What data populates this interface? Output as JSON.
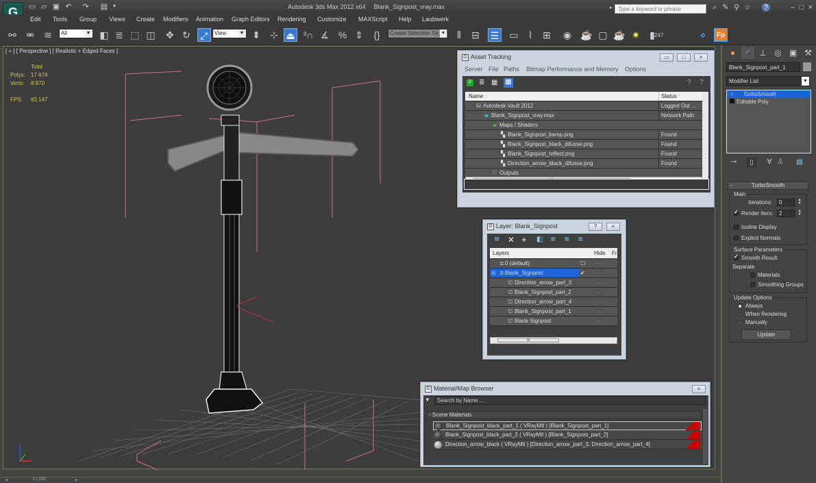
{
  "app": {
    "title": "Autodesk 3ds Max  2012 x64",
    "file": "Blank_Signpost_vray.max",
    "search_placeholder": "Type a keyword or phrase",
    "logo": "G"
  },
  "menu": [
    "Edit",
    "Tools",
    "Group",
    "Views",
    "Create",
    "Modifiers",
    "Animation",
    "Graph Editors",
    "Rendering",
    "Customize",
    "MAXScript",
    "Help",
    "Laubwerk"
  ],
  "toolbar": {
    "selection_filter": "All",
    "ref_coord": "View",
    "named_selection": "Create Selection Se",
    "count": "247",
    "fp_label": "Fp"
  },
  "viewport": {
    "label": "[ + ] [ Perspective ] [ Realistic + Edged Faces ]",
    "stats": {
      "total_label": "Total",
      "polys_label": "Polys:",
      "polys": "17 674",
      "verts_label": "Verts:",
      "verts": "8 870",
      "fps_label": "FPS:",
      "fps": "83.147"
    }
  },
  "timeline": {
    "frame": "0 / 100"
  },
  "command_panel": {
    "object_name": "Blank_Signpost_part_1",
    "modifier_list": "Modifier List",
    "stack": [
      "TurboSmooth",
      "Editable Poly"
    ],
    "rollout_title": "TurboSmooth",
    "main_group": "Main",
    "iterations_label": "Iterations:",
    "iterations": "0",
    "render_iters_label": "Render Iters:",
    "render_iters": "2",
    "render_iters_checked": true,
    "isoline_label": "Isoline Display",
    "explicit_normals_label": "Explicit Normals",
    "surface_group": "Surface Parameters",
    "smooth_result_label": "Smooth Result",
    "separate_label": "Separate",
    "materials_label": "Materials",
    "smoothing_groups_label": "Smoothing Groups",
    "update_group": "Update Options",
    "always_label": "Always",
    "when_rendering_label": "When Rendering",
    "manually_label": "Manually",
    "update_button": "Update"
  },
  "asset_tracking": {
    "title": "Asset Tracking",
    "menu": [
      "Server",
      "File",
      "Paths",
      "Bitmap Performance and Memory",
      "Options"
    ],
    "columns": [
      "Name",
      "Status"
    ],
    "rows": [
      {
        "name": "Autodesk Vault 2012",
        "status": "Logged Out ..."
      },
      {
        "name": "Blank_Signpost_vray.max",
        "status": "Network Path"
      },
      {
        "name": "Maps / Shaders",
        "status": ""
      },
      {
        "name": "Blank_Signpost_bamp.png",
        "status": "Found"
      },
      {
        "name": "Blank_Signpost_black_difusse.png",
        "status": "Found"
      },
      {
        "name": "Blank_Signpost_reflect.png",
        "status": "Found"
      },
      {
        "name": "Direction_arrow_black_difusse.png",
        "status": "Found"
      },
      {
        "name": "Outputs",
        "status": ""
      }
    ]
  },
  "layer_dialog": {
    "title": "Layer: Blank_Signpost",
    "columns": [
      "Layers",
      "Hide",
      "Fr"
    ],
    "rows": [
      {
        "name": "0 (default)"
      },
      {
        "name": "Blank_Signpost"
      },
      {
        "name": "Direction_arrow_part_3"
      },
      {
        "name": "Blank_Signpost_part_2"
      },
      {
        "name": "Direction_arrow_part_4"
      },
      {
        "name": "Blank_Signpost_part_1"
      },
      {
        "name": "Blank Signpost"
      }
    ]
  },
  "material_browser": {
    "title": "Material/Map Browser",
    "search_placeholder": "Search by Name ...",
    "section": "- Scene Materials",
    "items": [
      "Blank_Signpost_black_part_1 ( VRayMtl ) [Blank_Signpost_part_1]",
      "Blank_Signpost_black_part_2 ( VRayMtl ) [Blank_Signpost_part_2]",
      "Direction_arrow_black  ( VRayMtl ) [Direction_arrow_part_3, Direction_arrow_part_4]"
    ]
  }
}
